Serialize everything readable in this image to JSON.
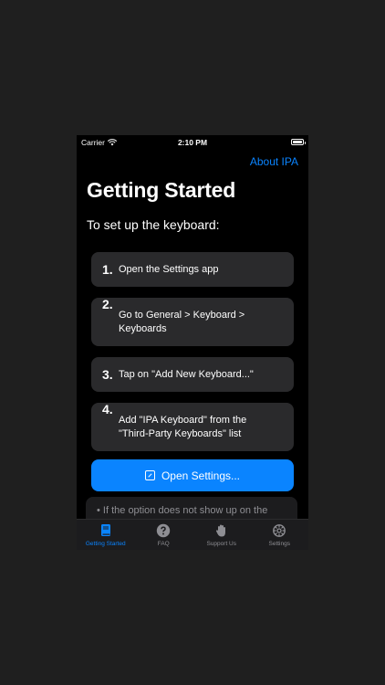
{
  "status_bar": {
    "carrier": "Carrier",
    "time": "2:10 PM"
  },
  "header": {
    "about_link": "About IPA",
    "title": "Getting Started"
  },
  "subtitle": "To set up the keyboard:",
  "steps": [
    {
      "num": "1.",
      "text": "Open the Settings app"
    },
    {
      "num": "2.",
      "text": "Go to General > Keyboard > Keyboards"
    },
    {
      "num": "3.",
      "text": "Tap on \"Add New Keyboard...\""
    },
    {
      "num": "4.",
      "text": "Add \"IPA Keyboard\" from the \"Third-Party Keyboards\" list"
    }
  ],
  "open_settings_label": "Open Settings...",
  "note": {
    "bullet": "•",
    "text": "If the option does not show up on the"
  },
  "tabs": [
    {
      "label": "Getting Started",
      "icon": "book-icon",
      "active": true
    },
    {
      "label": "FAQ",
      "icon": "question-circle-icon",
      "active": false
    },
    {
      "label": "Support Us",
      "icon": "hand-wave-icon",
      "active": false
    },
    {
      "label": "Settings",
      "icon": "gear-icon",
      "active": false
    }
  ],
  "colors": {
    "accent": "#0a84ff",
    "card": "#2a2a2c",
    "background": "#000000",
    "inactive": "#8e8e93"
  }
}
